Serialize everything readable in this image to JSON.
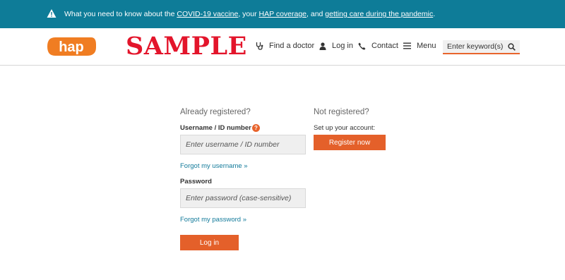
{
  "alert": {
    "prefix": "What you need to know about the ",
    "link1": "COVID-19 vaccine",
    "sep1": ", your ",
    "link2": "HAP coverage",
    "sep2": ", and ",
    "link3": "getting care during the pandemic",
    "suffix": "."
  },
  "brand": {
    "logo_text": "hap",
    "watermark": "SAMPLE",
    "accent": "#e8642c",
    "teal": "#0e7c98"
  },
  "nav": {
    "find_doctor": "Find a doctor",
    "login": "Log in",
    "contact": "Contact",
    "menu": "Menu",
    "search_placeholder": "Enter keyword(s)"
  },
  "login": {
    "registered_title": "Already registered?",
    "username_label": "Username / ID number",
    "username_placeholder": "Enter username / ID number",
    "forgot_username": "Forgot my username »",
    "password_label": "Password",
    "password_placeholder": "Enter password (case-sensitive)",
    "forgot_password": "Forgot my password »",
    "login_button": "Log in"
  },
  "register": {
    "title": "Not registered?",
    "setup_label": "Set up your account:",
    "button": "Register now"
  }
}
